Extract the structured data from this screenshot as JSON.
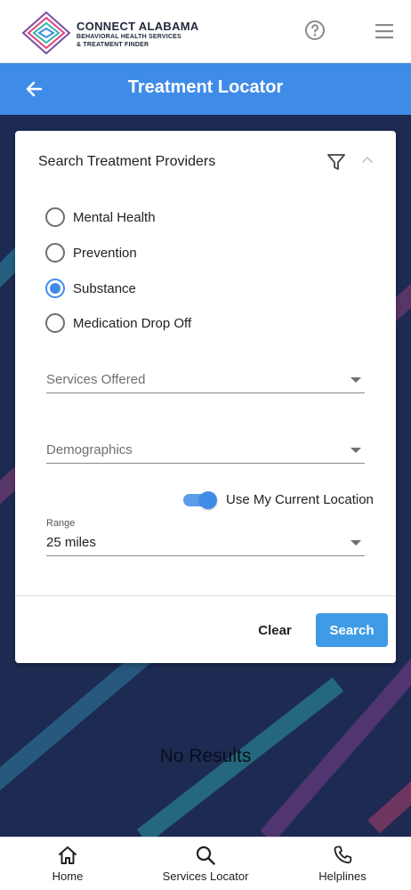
{
  "header": {
    "logo_title": "CONNECT ALABAMA",
    "logo_subtitle_line1": "BEHAVIORAL HEALTH SERVICES",
    "logo_subtitle_line2": "& TREATMENT FINDER",
    "help_icon": "help-circle-icon",
    "menu_icon": "hamburger-menu-icon"
  },
  "title_bar": {
    "title": "Treatment Locator",
    "back_icon": "arrow-left-icon"
  },
  "card": {
    "title": "Search Treatment Providers",
    "filter_icon": "filter-icon",
    "collapse_icon": "chevron-up-icon",
    "options": [
      {
        "label": "Mental Health",
        "checked": false
      },
      {
        "label": "Prevention",
        "checked": false
      },
      {
        "label": "Substance",
        "checked": true
      },
      {
        "label": "Medication Drop Off",
        "checked": false
      }
    ],
    "services_placeholder": "Services Offered",
    "demographics_placeholder": "Demographics",
    "location_toggle": {
      "label": "Use My Current Location",
      "on": true
    },
    "range": {
      "label": "Range",
      "value": "25 miles"
    },
    "clear_label": "Clear",
    "search_label": "Search"
  },
  "results": {
    "empty_text": "No Results"
  },
  "bottom_nav": [
    {
      "label": "Home",
      "icon": "home-icon"
    },
    {
      "label": "Services Locator",
      "icon": "search-icon"
    },
    {
      "label": "Helplines",
      "icon": "phone-icon"
    }
  ],
  "colors": {
    "primary": "#3f8ce8",
    "background": "#1d2a52",
    "search_button": "#3f9be6"
  }
}
